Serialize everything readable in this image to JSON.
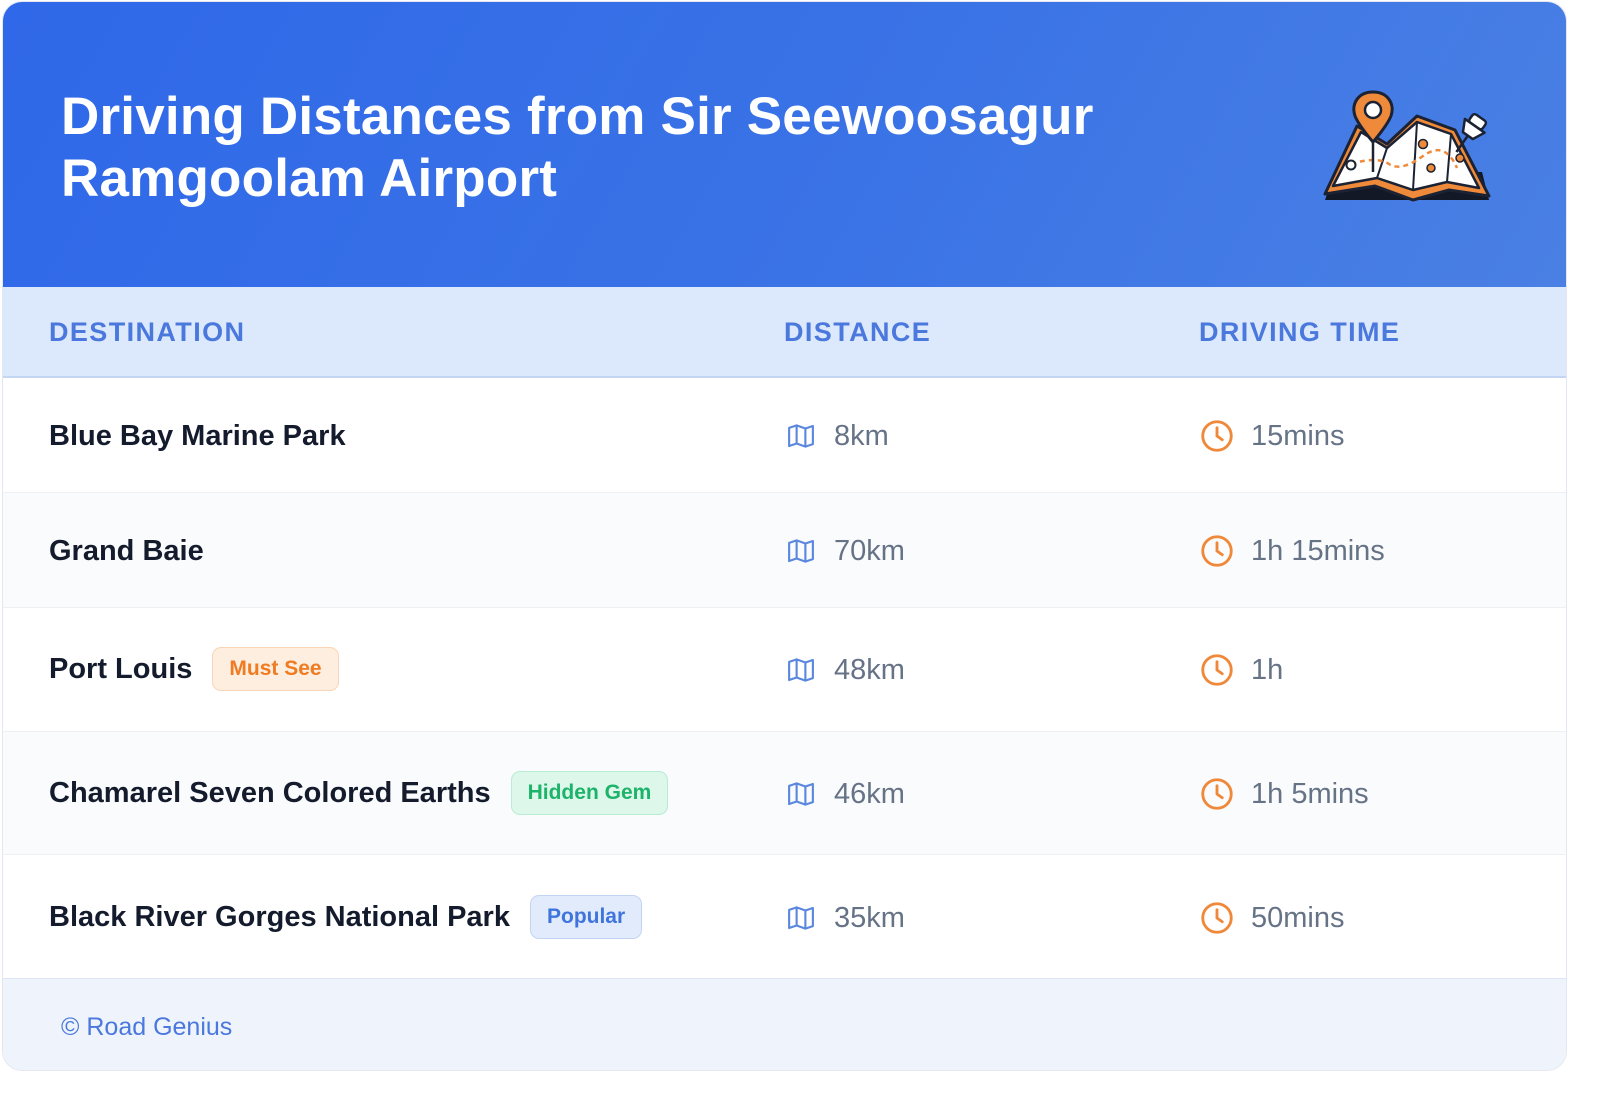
{
  "header": {
    "title": "Driving Distances from Sir Seewoosagur Ramgoolam Airport"
  },
  "table": {
    "columns": {
      "destination": "DESTINATION",
      "distance": "DISTANCE",
      "driving_time": "DRIVING TIME"
    },
    "rows": [
      {
        "destination": "Blue Bay Marine Park",
        "badge": "",
        "distance": "8km",
        "time": "15mins"
      },
      {
        "destination": "Grand Baie",
        "badge": "",
        "distance": "70km",
        "time": "1h 15mins"
      },
      {
        "destination": "Port Louis",
        "badge": "Must See",
        "distance": "48km",
        "time": "1h"
      },
      {
        "destination": "Chamarel Seven Colored Earths",
        "badge": "Hidden Gem",
        "distance": "46km",
        "time": "1h 5mins"
      },
      {
        "destination": "Black River Gorges National Park",
        "badge": "Popular",
        "distance": "35km",
        "time": "50mins"
      }
    ]
  },
  "footer": {
    "text": "© Road Genius"
  },
  "icons": {
    "header_illustration": "map-with-pins-icon",
    "distance": "map-icon",
    "time": "clock-icon"
  },
  "colors": {
    "header_gradient_start": "#2f68e8",
    "header_gradient_end": "#4a80e4",
    "accent_blue": "#4a78dd",
    "clock_orange": "#f0883a",
    "badge_must_see": "#ef7b22",
    "badge_hidden_gem": "#1db36a",
    "badge_popular": "#3f74dc"
  }
}
